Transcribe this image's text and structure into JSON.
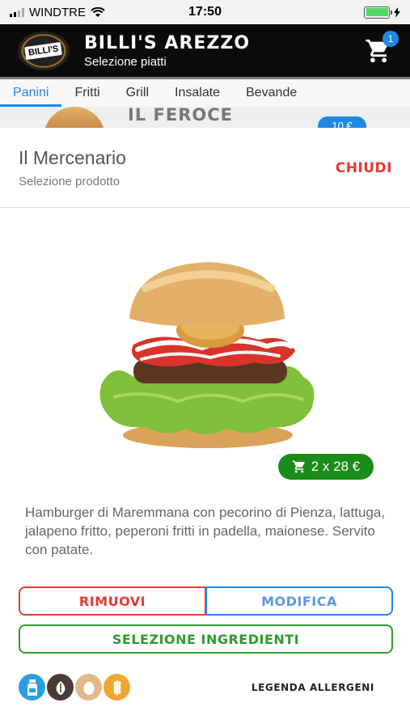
{
  "status_bar": {
    "carrier": "WINDTRE",
    "time": "17:50"
  },
  "header": {
    "title": "BILLI'S AREZZO",
    "subtitle": "Selezione piatti",
    "logo_text": "BILLI'S",
    "cart_count": "1"
  },
  "tabs": [
    {
      "label": "Panini",
      "active": true
    },
    {
      "label": "Fritti"
    },
    {
      "label": "Grill"
    },
    {
      "label": "Insalate"
    },
    {
      "label": "Bevande"
    }
  ],
  "background_item": {
    "title": "IL FEROCE",
    "price": "10 €"
  },
  "modal": {
    "title": "Il Mercenario",
    "subtitle": "Selezione prodotto",
    "close_label": "CHIUDI",
    "price_label": "2 x 28 €",
    "description": "Hamburger di Maremmana con pecorino di Pienza, lattuga, jalapeno fritto, peperoni fritti in padella, maionese. Servito con patate.",
    "remove_label": "RIMUOVI",
    "modify_label": "MODIFICA",
    "ingredients_label": "SELEZIONE INGREDIENTI",
    "legend_label": "LEGENDA ALLERGENI",
    "allergen_icons": [
      "milk-icon",
      "nuts-icon",
      "egg-icon",
      "gluten-icon"
    ]
  },
  "colors": {
    "accent_blue": "#1e88e5",
    "danger_red": "#e53935",
    "success_green": "#2e9b2e",
    "price_green": "#1a8c1a"
  }
}
